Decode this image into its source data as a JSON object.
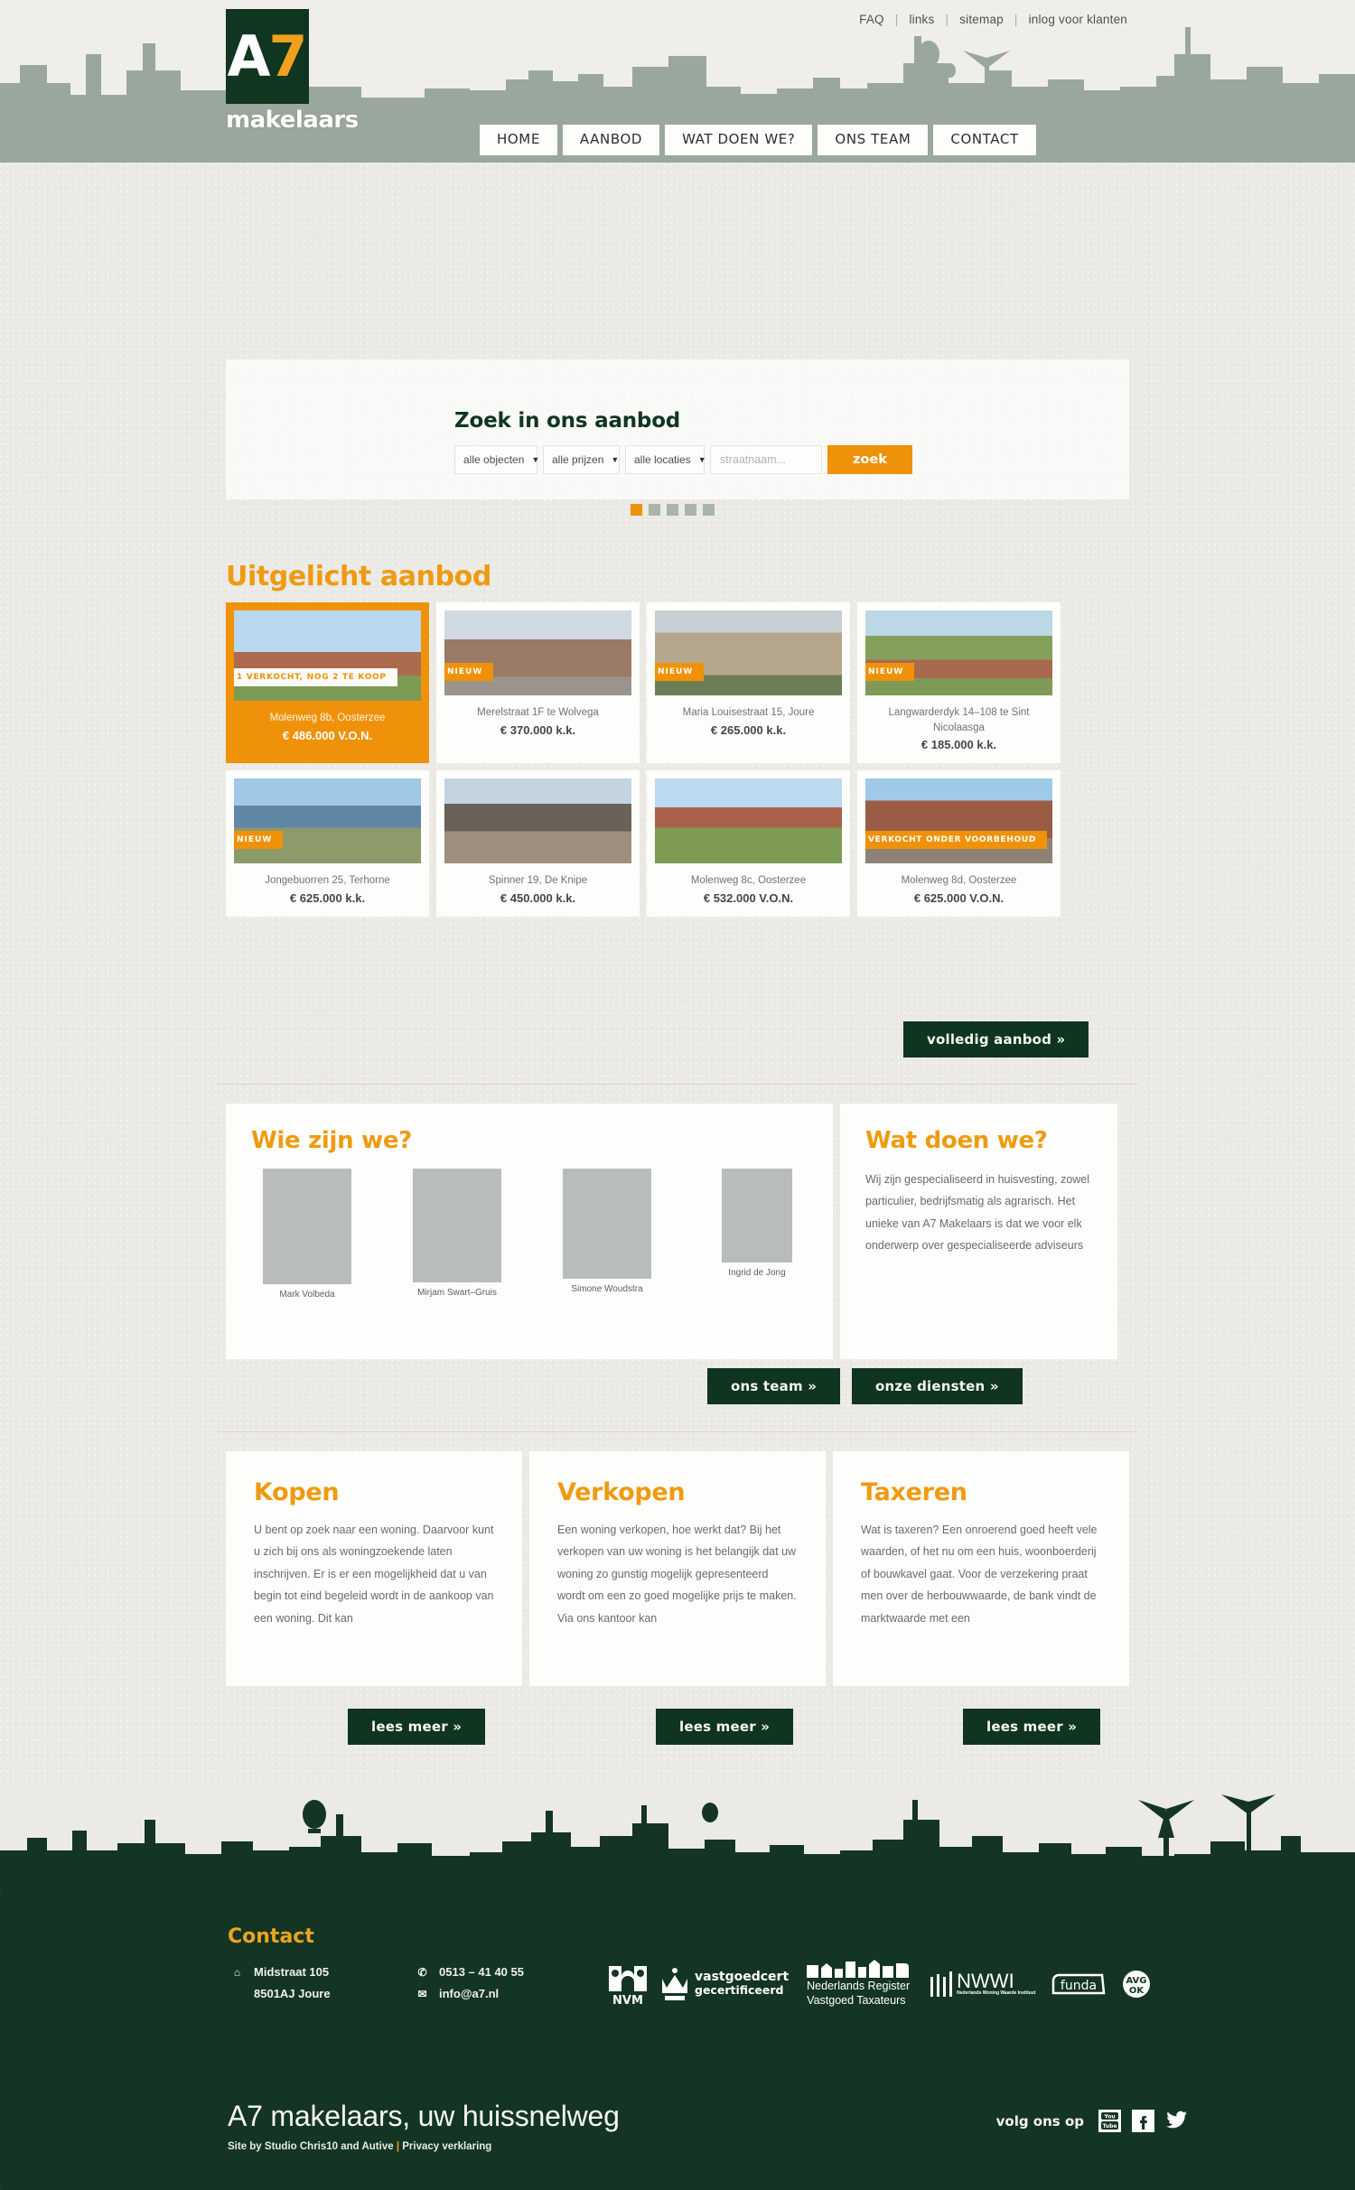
{
  "brand": {
    "logo_a": "A",
    "logo_7": "7",
    "logo_sub": "makelaars"
  },
  "toplinks": [
    {
      "label": "FAQ"
    },
    {
      "label": "links"
    },
    {
      "label": "sitemap"
    },
    {
      "label": "inlog voor klanten"
    }
  ],
  "mainnav": [
    {
      "label": "HOME"
    },
    {
      "label": "AANBOD"
    },
    {
      "label": "WAT DOEN WE?"
    },
    {
      "label": "ONS TEAM"
    },
    {
      "label": "CONTACT"
    }
  ],
  "hero": {
    "search_title": "Zoek in ons aanbod",
    "select_objects": "alle objecten",
    "select_prices": "alle prijzen",
    "select_locations": "alle locaties",
    "street_placeholder": "straatnaam...",
    "search_button": "zoek",
    "carousel_slides": 5,
    "carousel_active": 1
  },
  "featured": {
    "title": "Uitgelicht aanbod",
    "more_button": "volledig aanbod »",
    "items": [
      {
        "address": "Molenweg 8b, Oosterzee",
        "price": "€ 486.000 V.O.N.",
        "badge": "1 VERKOCHT, NOG 2 TE KOOP",
        "badge_style": "white",
        "highlight": true
      },
      {
        "address": "Merelstraat 1F te Wolvega",
        "price": "€ 370.000 k.k.",
        "badge": "NIEUW",
        "badge_style": "orange",
        "highlight": false
      },
      {
        "address": "Maria Louisestraat 15, Joure",
        "price": "€ 265.000 k.k.",
        "badge": "NIEUW",
        "badge_style": "orange",
        "highlight": false
      },
      {
        "address": "Langwarderdyk 14–108 te Sint Nicolaasga",
        "price": "€ 185.000 k.k.",
        "badge": "NIEUW",
        "badge_style": "orange",
        "highlight": false
      },
      {
        "address": "Jongebuorren 25, Terhorne",
        "price": "€ 625.000 k.k.",
        "badge": "NIEUW",
        "badge_style": "orange",
        "highlight": false
      },
      {
        "address": "Spinner 19, De Knipe",
        "price": "€ 450.000 k.k.",
        "badge": "",
        "badge_style": "none",
        "highlight": false
      },
      {
        "address": "Molenweg 8c, Oosterzee",
        "price": "€ 532.000 V.O.N.",
        "badge": "",
        "badge_style": "none",
        "highlight": false
      },
      {
        "address": "Molenweg 8d, Oosterzee",
        "price": "€ 625.000 V.O.N.",
        "badge": "VERKOCHT ONDER VOORBEHOUD",
        "badge_style": "orange",
        "highlight": false
      }
    ]
  },
  "team_panel": {
    "title": "Wie zijn we?",
    "button": "ons team »",
    "members": [
      {
        "name": "Mark Volbeda"
      },
      {
        "name": "Mirjam Swart–Gruis"
      },
      {
        "name": "Simone Woudstra"
      },
      {
        "name": "Ingrid de Jong"
      }
    ]
  },
  "services_panel": {
    "title": "Wat doen we?",
    "text": "Wij zijn gespecialiseerd in huisvesting, zowel particulier, bedrijfsmatig als agrarisch. Het unieke van A7 Makelaars is dat we voor elk onderwerp over gespecialiseerde adviseurs",
    "button": "onze diensten »"
  },
  "columns": [
    {
      "title": "Kopen",
      "text": "U bent op zoek naar een woning. Daarvoor kunt u zich bij ons als woningzoekende laten inschrijven. Er is er een mogelijkheid dat u van begin tot eind begeleid wordt in de aankoop van een woning. Dit kan",
      "button": "lees meer »"
    },
    {
      "title": "Verkopen",
      "text": "Een woning verkopen, hoe werkt dat? Bij het verkopen van uw woning is het belangijk dat uw woning zo gunstig mogelijk gepresenteerd wordt om een zo goed mogelijke prijs te maken. Via ons kantoor kan",
      "button": "lees meer »"
    },
    {
      "title": "Taxeren",
      "text": "Wat is taxeren? Een onroerend goed heeft vele waarden, of het nu om een huis, woonboerderij of bouwkavel gaat. Voor de verzekering praat men over de herbouwwaarde, de bank vindt de marktwaarde met een",
      "button": "lees meer »"
    }
  ],
  "footer": {
    "contact_title": "Contact",
    "address_line1": "Midstraat 105",
    "address_line2": "8501AJ Joure",
    "phone": "0513 – 41 40 55",
    "email": "info@a7.nl",
    "partners": [
      {
        "name": "NVM"
      },
      {
        "name": "vastgoedcert gecertificeerd",
        "line1": "vastgoedcert",
        "line2": "gecertificeerd"
      },
      {
        "name": "Nederlands Register Vastgoed Taxateurs",
        "line1": "Nederlands Register",
        "line2": "Vastgoed Taxateurs"
      },
      {
        "name": "NWWI",
        "line1": "NWWI",
        "line2": "Nederlands Woning Waarde Instituut"
      },
      {
        "name": "funda"
      },
      {
        "name": "AVG OK",
        "line1": "AVG",
        "line2": "OK"
      }
    ],
    "claim": "A7 makelaars, uw huissnelweg",
    "byline_a": "Site by Studio Chris10 and Autive",
    "byline_bar": "|",
    "byline_b": "Privacy verklaring",
    "social_label": "volg ons op",
    "social": [
      {
        "name": "youtube"
      },
      {
        "name": "facebook"
      },
      {
        "name": "twitter"
      }
    ]
  },
  "colors": {
    "accent_orange": "#ef9209",
    "dark_green": "#143523",
    "paper": "#eceae5"
  }
}
